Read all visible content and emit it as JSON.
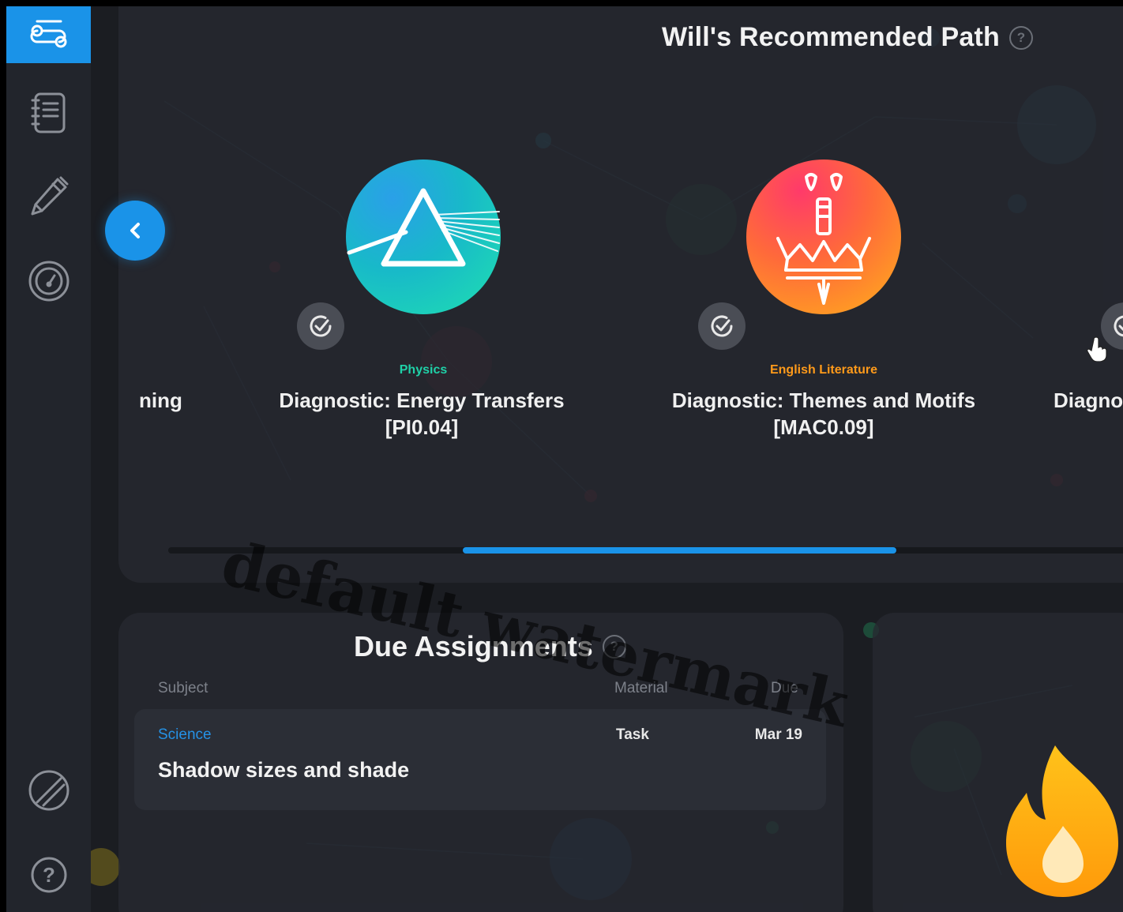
{
  "sidebar": {
    "items": [
      {
        "icon": "learning-path-icon",
        "active": true
      },
      {
        "icon": "notebook-icon",
        "active": false
      },
      {
        "icon": "pencil-icon",
        "active": false
      },
      {
        "icon": "speedometer-icon",
        "active": false
      }
    ],
    "bottom_items": [
      {
        "icon": "slash-circle-icon"
      },
      {
        "icon": "help-icon",
        "label": "?"
      }
    ]
  },
  "path": {
    "title": "Will's Recommended Path",
    "help": "?",
    "courses": [
      {
        "title": "ning"
      },
      {
        "subject": "Physics",
        "title_line1": "Diagnostic: Energy Transfers",
        "title_line2": "[PI0.04]",
        "icon": "prism-icon"
      },
      {
        "subject": "English Literature",
        "title_line1": "Diagnostic: Themes and Motifs",
        "title_line2": "[MAC0.09]",
        "icon": "crown-dagger-icon"
      },
      {
        "title": "Diagno"
      }
    ],
    "progress_fraction": 0.45
  },
  "due": {
    "title": "Due Assignments",
    "help": "?",
    "columns": {
      "subject": "Subject",
      "material": "Material",
      "due": "Due"
    },
    "rows": [
      {
        "subject": "Science",
        "name": "Shadow sizes and shade",
        "material": "Task",
        "due": "Mar 19"
      }
    ]
  },
  "watermark": "default watermark",
  "colors": {
    "accent": "#1a93e8",
    "physics": "#1fd1a8",
    "english": "#ff9a1a",
    "background": "#1b1d22"
  }
}
